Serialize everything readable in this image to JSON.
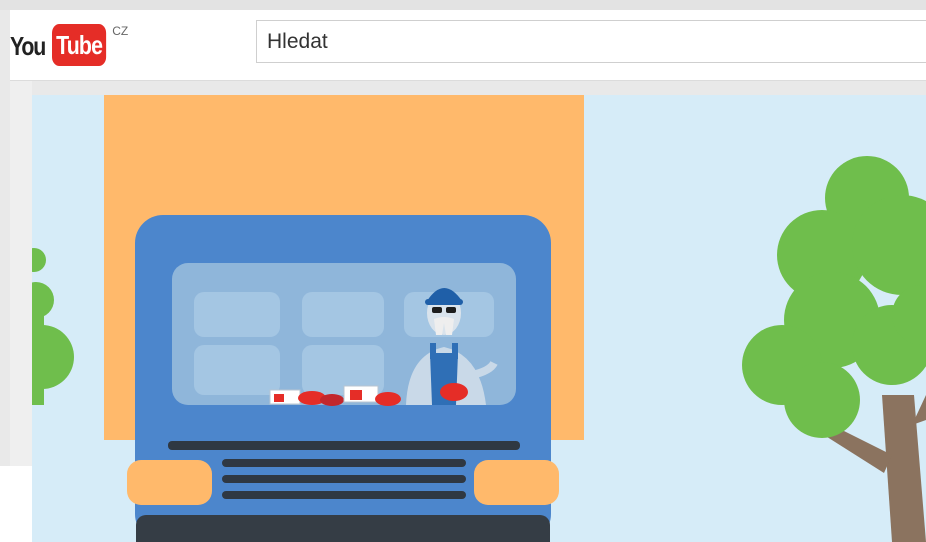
{
  "header": {
    "logo": {
      "you": "You",
      "tube": "Tube",
      "country": "CZ"
    },
    "search": {
      "placeholder": "Hledat"
    }
  },
  "video": {
    "scene": "animated-truck-with-driver",
    "colors": {
      "sky": "#d6ecf8",
      "cargo": "#ffb96b",
      "cab": "#4c86cc",
      "window": "#8fb6da",
      "tree": "#6fbe4c",
      "trunk": "#8b735f",
      "bumper": "#353d45",
      "headlight": "#ffb96b"
    }
  }
}
